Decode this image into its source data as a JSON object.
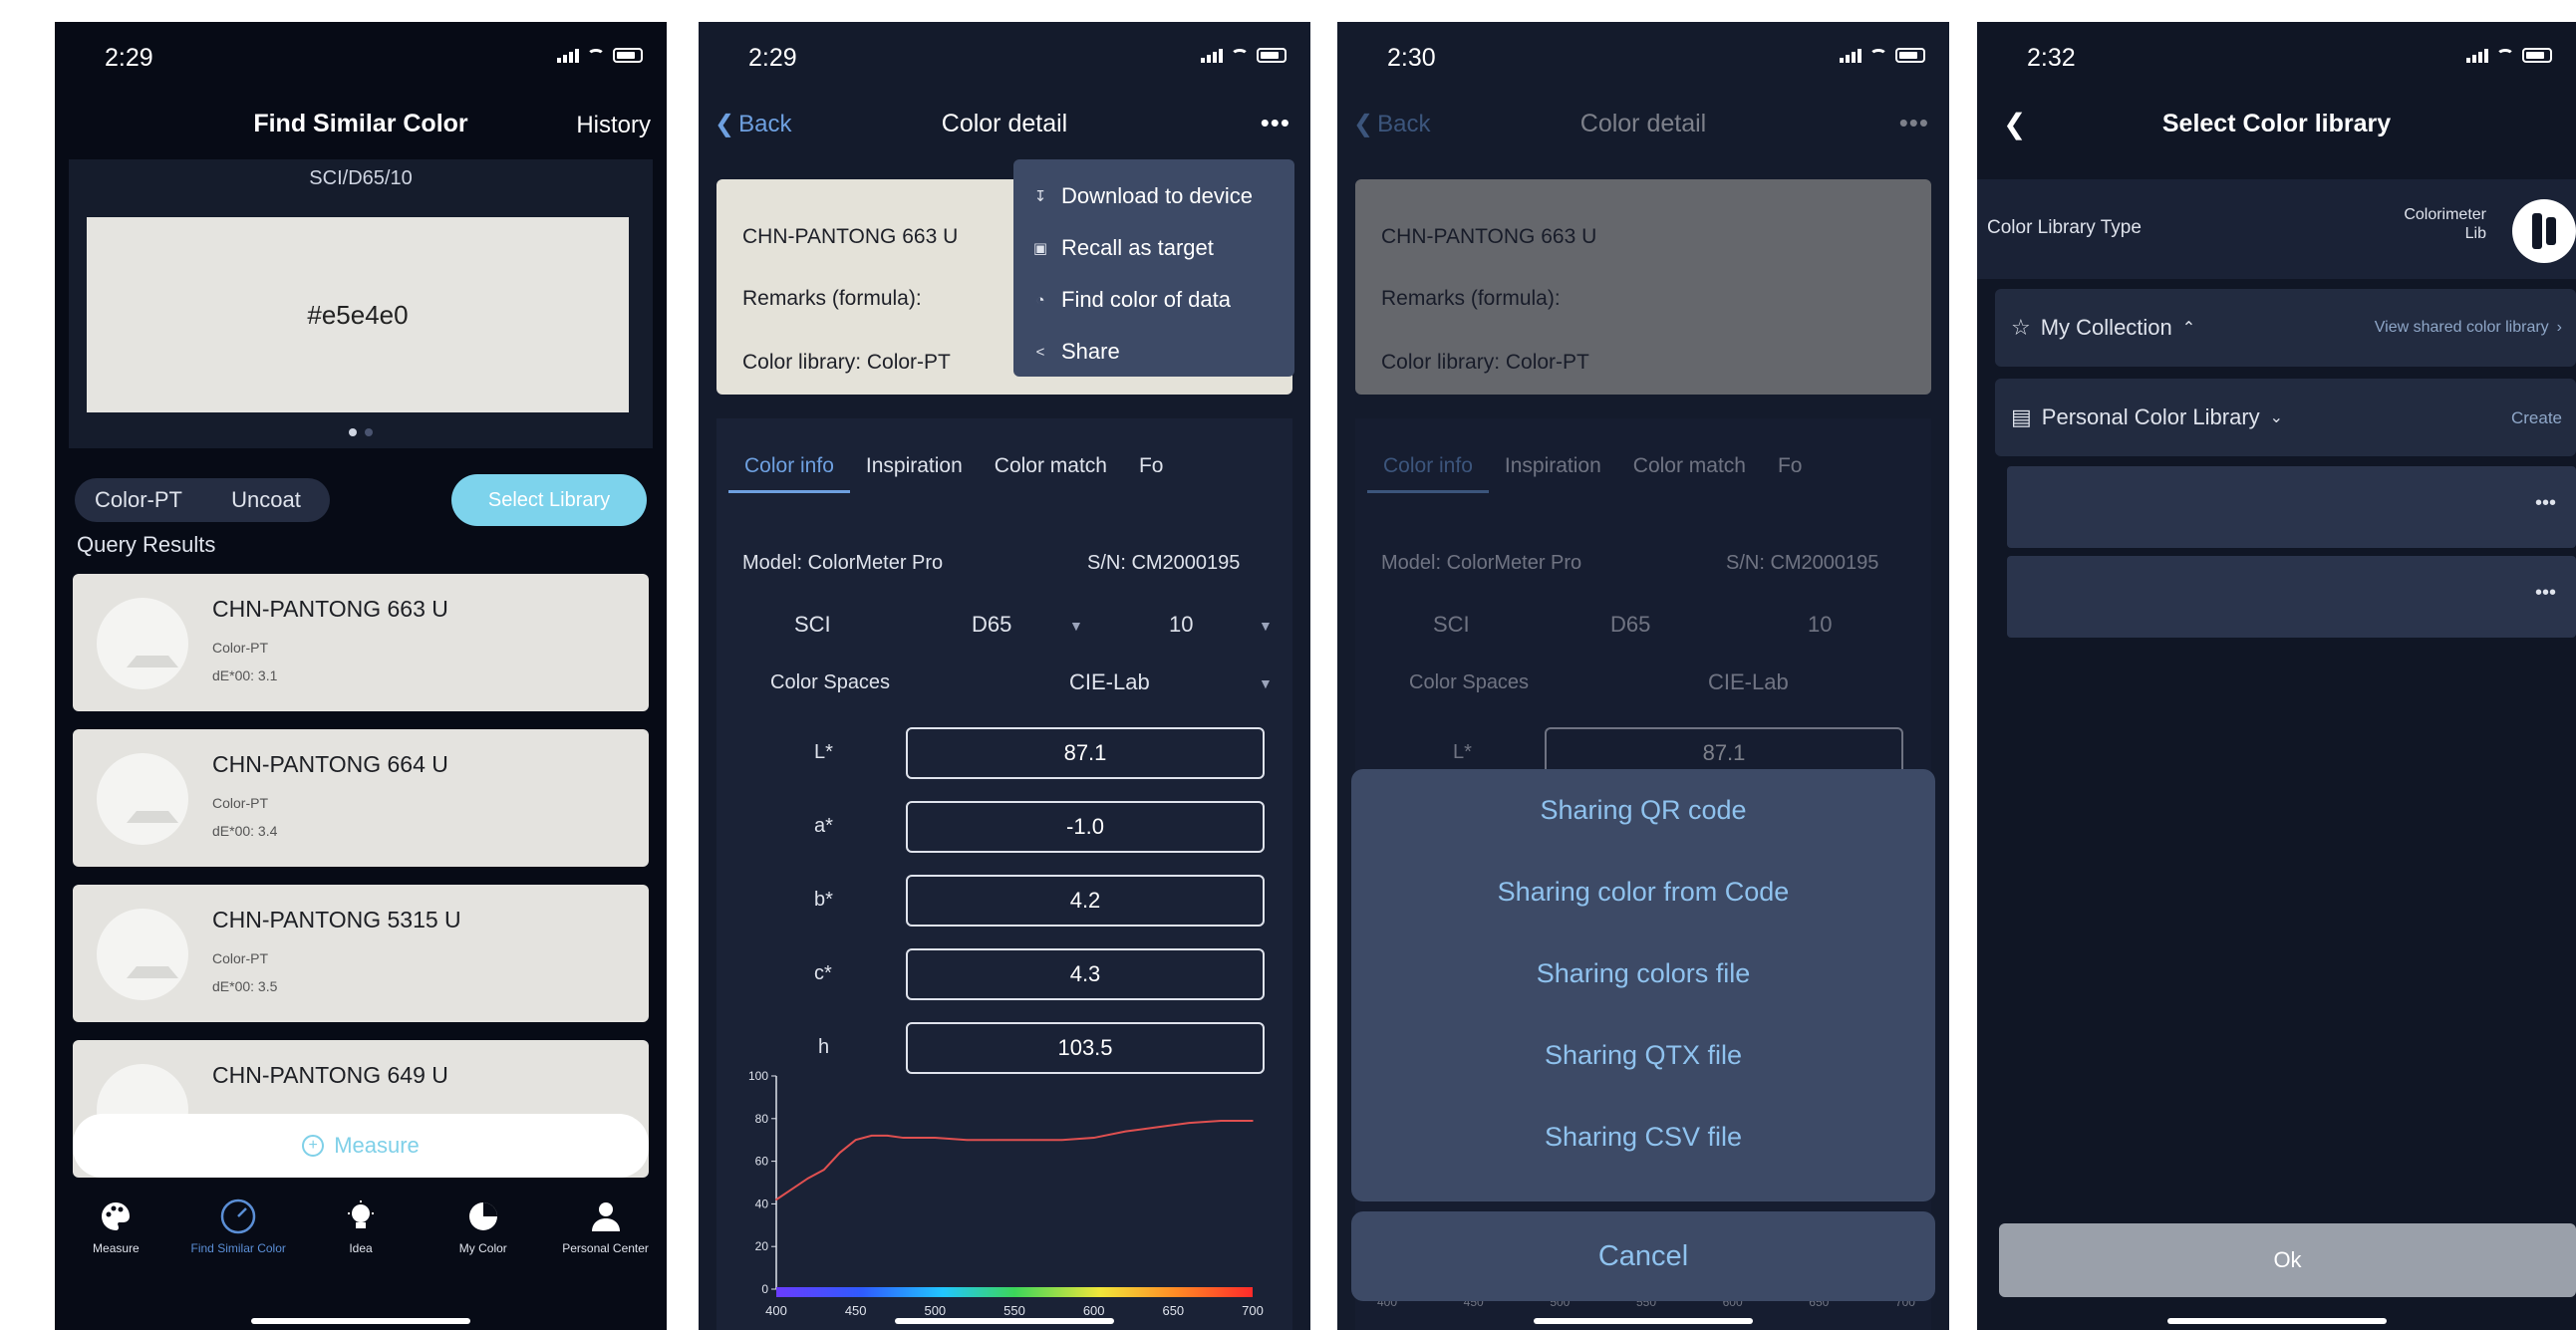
{
  "phone1": {
    "time": "2:29",
    "title": "Find Similar Color",
    "history": "History",
    "swatch_label": "SCI/D65/10",
    "swatch_hex": "#e5e4e0",
    "library": "Color-PT",
    "coat": "Uncoat",
    "select_library": "Select Library",
    "query_results": "Query Results",
    "results": [
      {
        "name": "CHN-PANTONG 663 U",
        "lib": "Color-PT",
        "de": "dE*00: 3.1"
      },
      {
        "name": "CHN-PANTONG 664 U",
        "lib": "Color-PT",
        "de": "dE*00: 3.4"
      },
      {
        "name": "CHN-PANTONG 5315 U",
        "lib": "Color-PT",
        "de": "dE*00: 3.5"
      },
      {
        "name": "CHN-PANTONG 649 U",
        "lib": "",
        "de": ""
      }
    ],
    "measure": "Measure",
    "tabs": [
      "Measure",
      "Find Similar Color",
      "Idea",
      "My Color",
      "Personal Center"
    ]
  },
  "phone2": {
    "time": "2:29",
    "back": "Back",
    "title": "Color detail",
    "card": {
      "name": "CHN-PANTONG 663 U",
      "remarks": "Remarks (formula):",
      "library": "Color library: Color-PT"
    },
    "menu": [
      "Download to device",
      "Recall as target",
      "Find color of data",
      "Share"
    ],
    "tabs": [
      "Color info",
      "Inspiration",
      "Color match",
      "Fo"
    ],
    "model": "Model:  ColorMeter Pro",
    "sn": "S/N:  CM2000195",
    "mode": "SCI",
    "illuminant": "D65",
    "observer": "10",
    "color_spaces_label": "Color Spaces",
    "color_space": "CIE-Lab",
    "values": [
      {
        "label": "L*",
        "value": "87.1"
      },
      {
        "label": "a*",
        "value": "-1.0"
      },
      {
        "label": "b*",
        "value": "4.2"
      },
      {
        "label": "c*",
        "value": "4.3"
      },
      {
        "label": "h",
        "value": "103.5"
      }
    ]
  },
  "chart_data": {
    "type": "line",
    "title": "",
    "xlabel": "",
    "ylabel": "",
    "x": [
      400,
      410,
      420,
      430,
      440,
      450,
      460,
      470,
      480,
      490,
      500,
      520,
      540,
      560,
      580,
      600,
      620,
      640,
      660,
      680,
      700
    ],
    "y": [
      42,
      47,
      52,
      56,
      64,
      70,
      72,
      72,
      71,
      71,
      71,
      70,
      70,
      70,
      70,
      71,
      74,
      76,
      78,
      79,
      79
    ],
    "xlim": [
      400,
      700
    ],
    "ylim": [
      0,
      100
    ],
    "xticks": [
      "400",
      "450",
      "500",
      "550",
      "600",
      "650",
      "700"
    ],
    "yticks": [
      "0",
      "20",
      "40",
      "60",
      "80",
      "100"
    ],
    "line_color": "#e05050"
  },
  "phone3": {
    "time": "2:30",
    "back": "Back",
    "title": "Color detail",
    "share_options": [
      "Sharing QR code",
      "Sharing color from Code",
      "Sharing colors file",
      "Sharing QTX file",
      "Sharing CSV file"
    ],
    "cancel": "Cancel",
    "l_value": "87.1",
    "xticks": [
      "400",
      "450",
      "500",
      "550",
      "600",
      "650",
      "700"
    ]
  },
  "phone4": {
    "time": "2:32",
    "title": "Select Color library",
    "lib_type_label": "Color Library Type",
    "lib_type_value": "Colorimeter Lib",
    "my_collection": "My Collection",
    "view_shared": "View shared color library",
    "personal": "Personal Color Library",
    "create": "Create",
    "ok": "Ok"
  },
  "colors": {
    "accent": "#6ea0e0",
    "select_button": "#7dd3ec",
    "swatch": "#e5e4e0"
  }
}
